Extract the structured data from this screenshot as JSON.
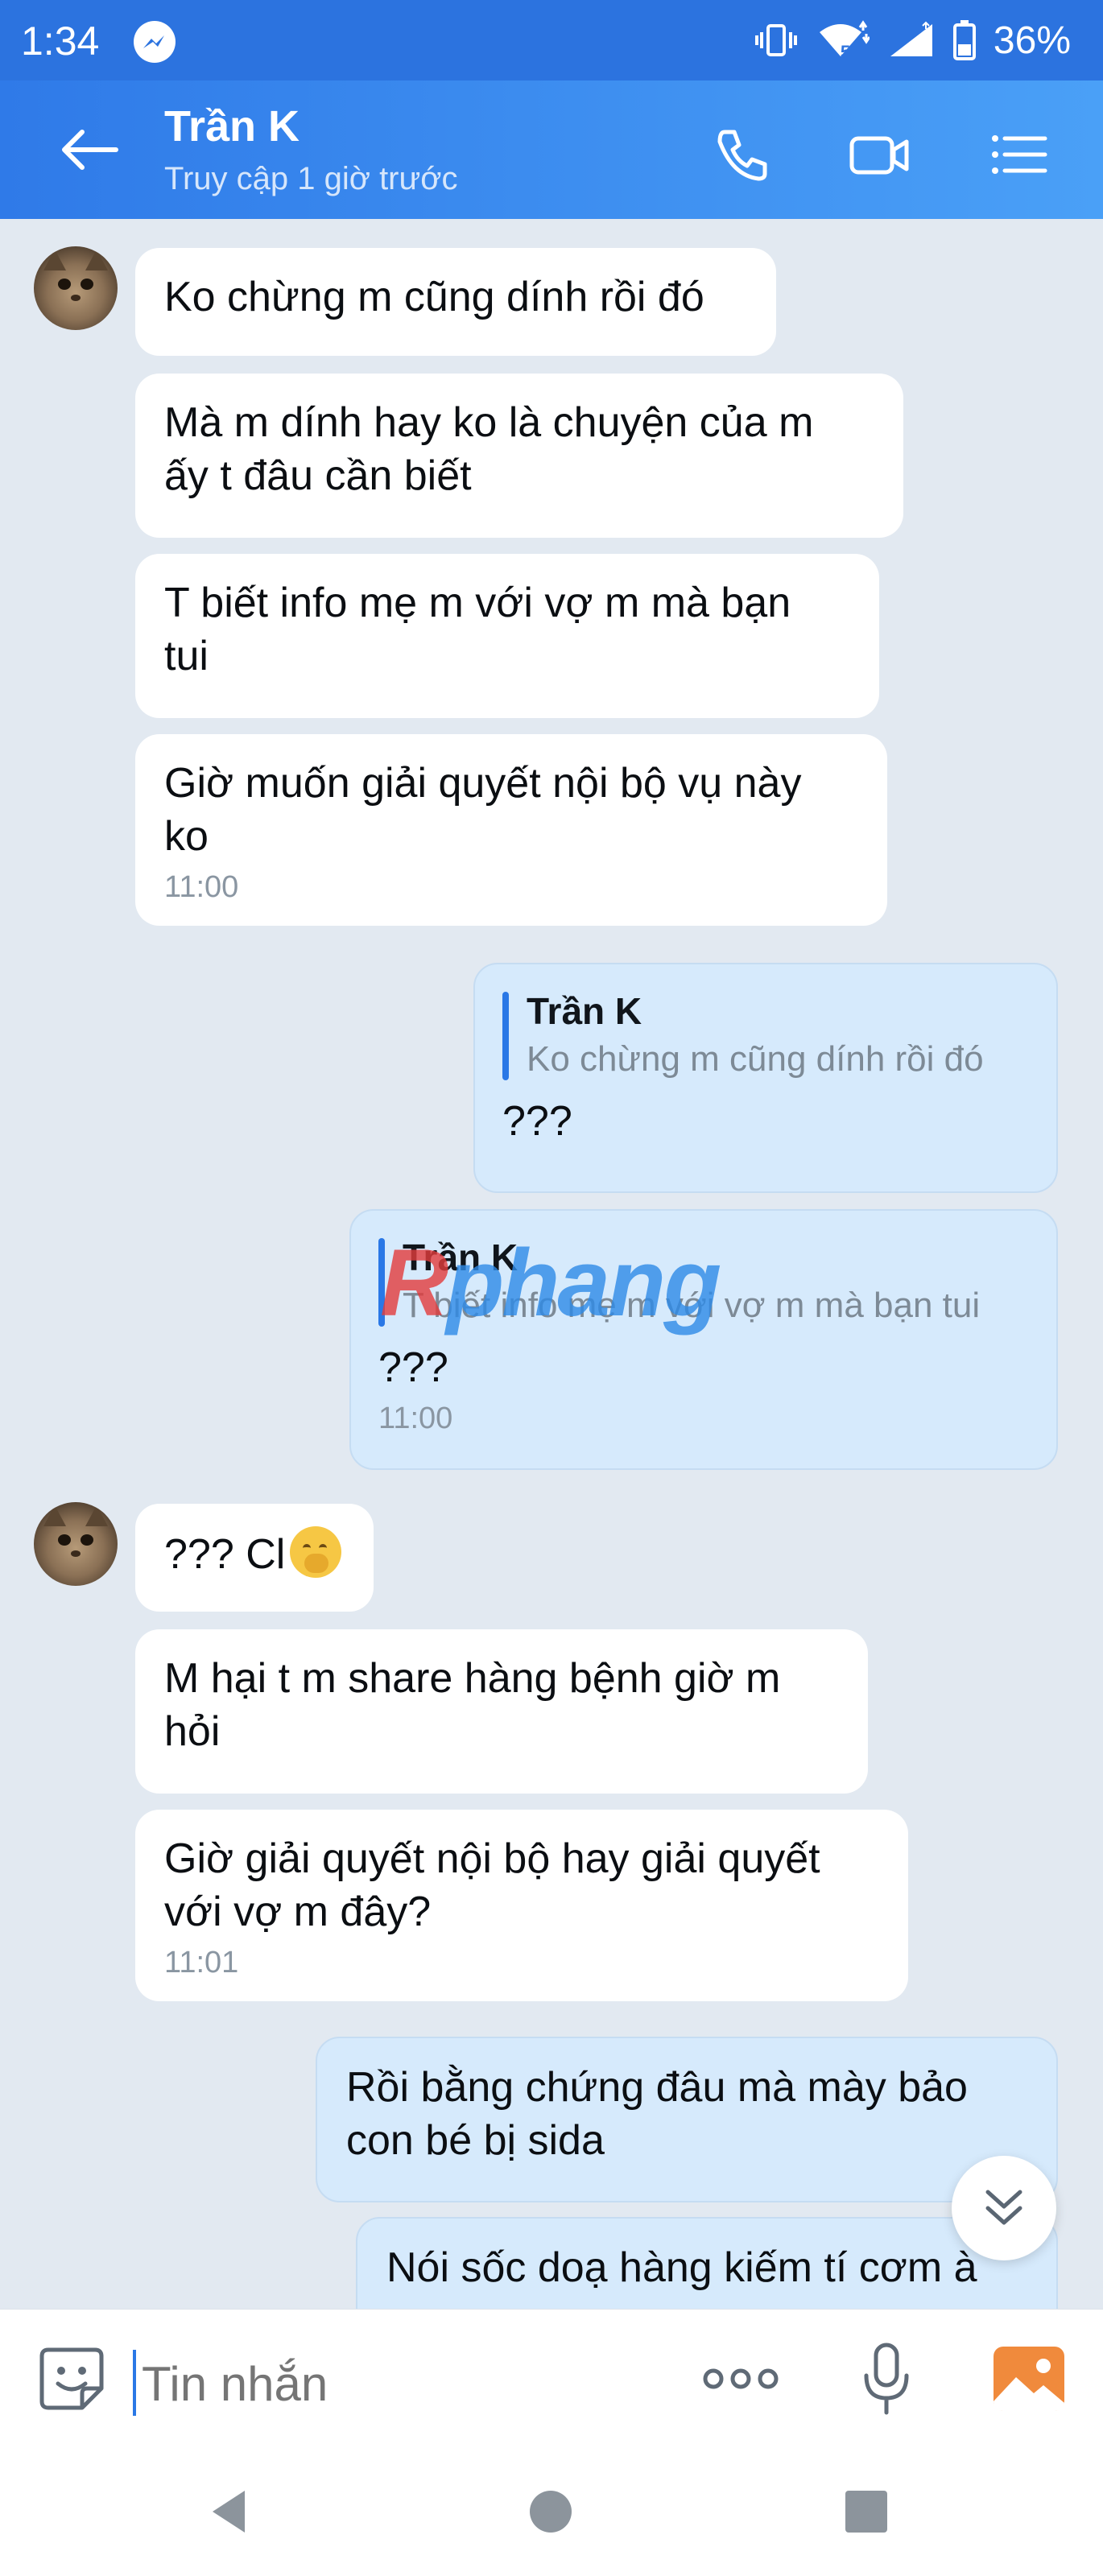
{
  "status_bar": {
    "time": "1:34",
    "network_label": "5",
    "battery": "36%",
    "icons": [
      "messenger-icon",
      "vibrate-icon",
      "wifi-icon",
      "signal-icon",
      "battery-icon"
    ]
  },
  "header": {
    "contact_name": "Trần K",
    "last_seen": "Truy cập 1 giờ trước",
    "icons": [
      "back-arrow-icon",
      "phone-icon",
      "video-call-icon",
      "menu-list-icon"
    ]
  },
  "messages": [
    {
      "side": "in",
      "text": "Ko chừng m cũng dính rồi đó"
    },
    {
      "side": "in",
      "text": "Mà m dính hay ko là chuyện của m\nấy t đâu cần biết"
    },
    {
      "side": "in",
      "text": "T biết info mẹ m với vợ m mà bạn\ntui"
    },
    {
      "side": "in",
      "text": "Giờ muốn giải quyết nội bộ vụ này\nko",
      "time": "11:00"
    },
    {
      "side": "out",
      "quote_name": "Trần K",
      "quote_text": "Ko chừng m cũng dính rồi đó",
      "text": "???"
    },
    {
      "side": "out",
      "quote_name": "Trần K",
      "quote_text": "T biết info mẹ m với vợ m mà bạn tui",
      "text": "???",
      "time": "11:00"
    },
    {
      "side": "in",
      "text": "??? Cl",
      "emoji": "thinking-face-emoji"
    },
    {
      "side": "in",
      "text": "M hại t m share hàng bệnh giờ m\nhỏi"
    },
    {
      "side": "in",
      "text": "Giờ giải quyết nội bộ hay giải quyết\nvới vợ m đây?",
      "time": "11:01"
    },
    {
      "side": "out",
      "text": "Rồi bằng chứng đâu mà mày bảo\ncon bé bị sida"
    },
    {
      "side": "out",
      "text": "Nói sốc doạ hàng kiếm tí cơm à"
    }
  ],
  "watermark": {
    "first": "R",
    "rest": "phang"
  },
  "input_bar": {
    "placeholder": "Tin nhắn",
    "icons": [
      "sticker-icon",
      "more-options-icon",
      "microphone-icon",
      "gallery-icon"
    ]
  },
  "colors": {
    "header_gradient_start": "#2f7ae8",
    "header_gradient_end": "#4aa0f7",
    "incoming_bubble": "#ffffff",
    "outgoing_bubble": "#d6eafc",
    "chat_background": "#e2e9f1",
    "quote_bar": "#2a78e6"
  }
}
